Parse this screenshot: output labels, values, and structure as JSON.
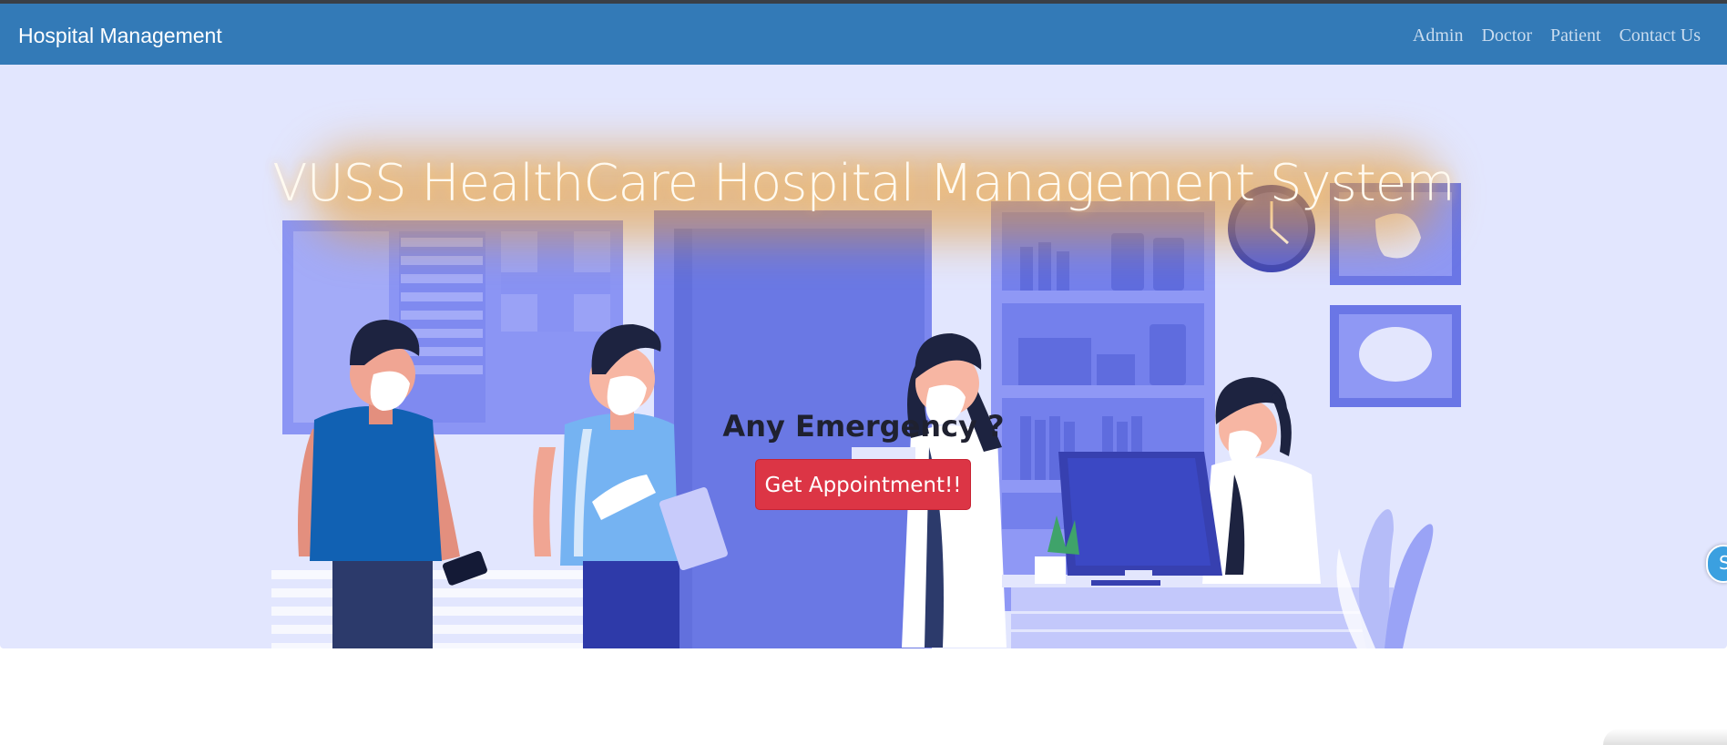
{
  "navbar": {
    "brand": "Hospital Management",
    "links": [
      "Admin",
      "Doctor",
      "Patient",
      "Contact Us"
    ]
  },
  "hero": {
    "title": "VUSS HealthCare Hospital Management System",
    "emergency_text": "Any Emergency ?",
    "button_label": "Get Appointment!!"
  },
  "side_widget": {
    "label": "S"
  },
  "colors": {
    "navbar": "#337ab7",
    "hero_background": "#e2e6fe",
    "button": "#dc3545"
  }
}
